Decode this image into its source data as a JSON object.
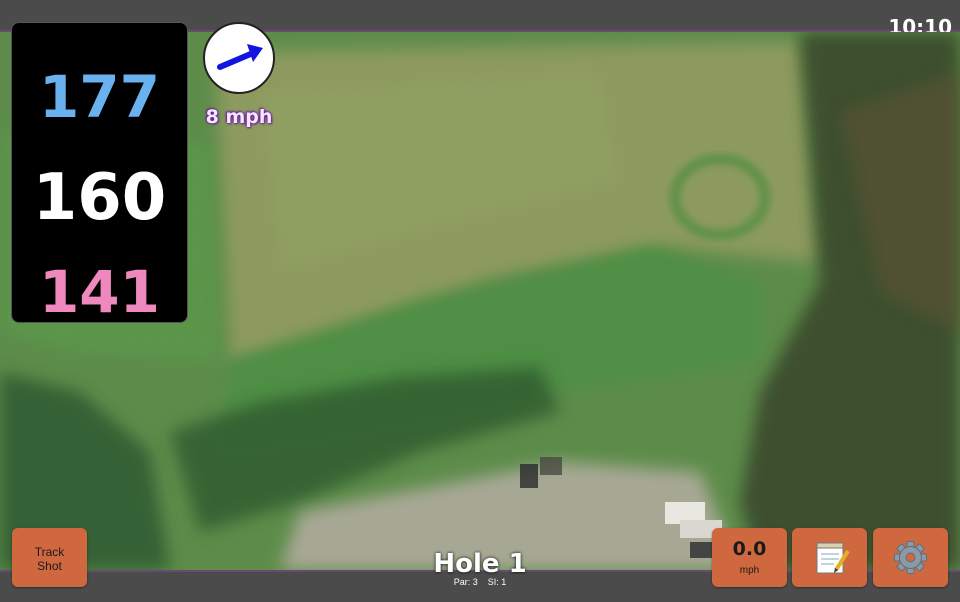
{
  "status_bar": {
    "clock": "10:10"
  },
  "yardages": {
    "back": "177",
    "middle": "160",
    "front": "141"
  },
  "wind": {
    "speed_label": "8 mph",
    "icon": "wind-direction-arrow-icon"
  },
  "hole": {
    "title": "Hole 1",
    "par_label": "Par: 3",
    "si_label": "SI: 1"
  },
  "buttons": {
    "track_shot_line1": "Track",
    "track_shot_line2": "Shot",
    "speed_value": "0.0",
    "speed_unit": "mph",
    "notes_icon": "notepad-icon",
    "settings_icon": "gear-icon"
  },
  "colors": {
    "back_yardage": "#6ab2ef",
    "middle_yardage": "#ffffff",
    "front_yardage": "#ee88bd",
    "button": "#d0683f",
    "wind_arrow": "#1414e0"
  }
}
